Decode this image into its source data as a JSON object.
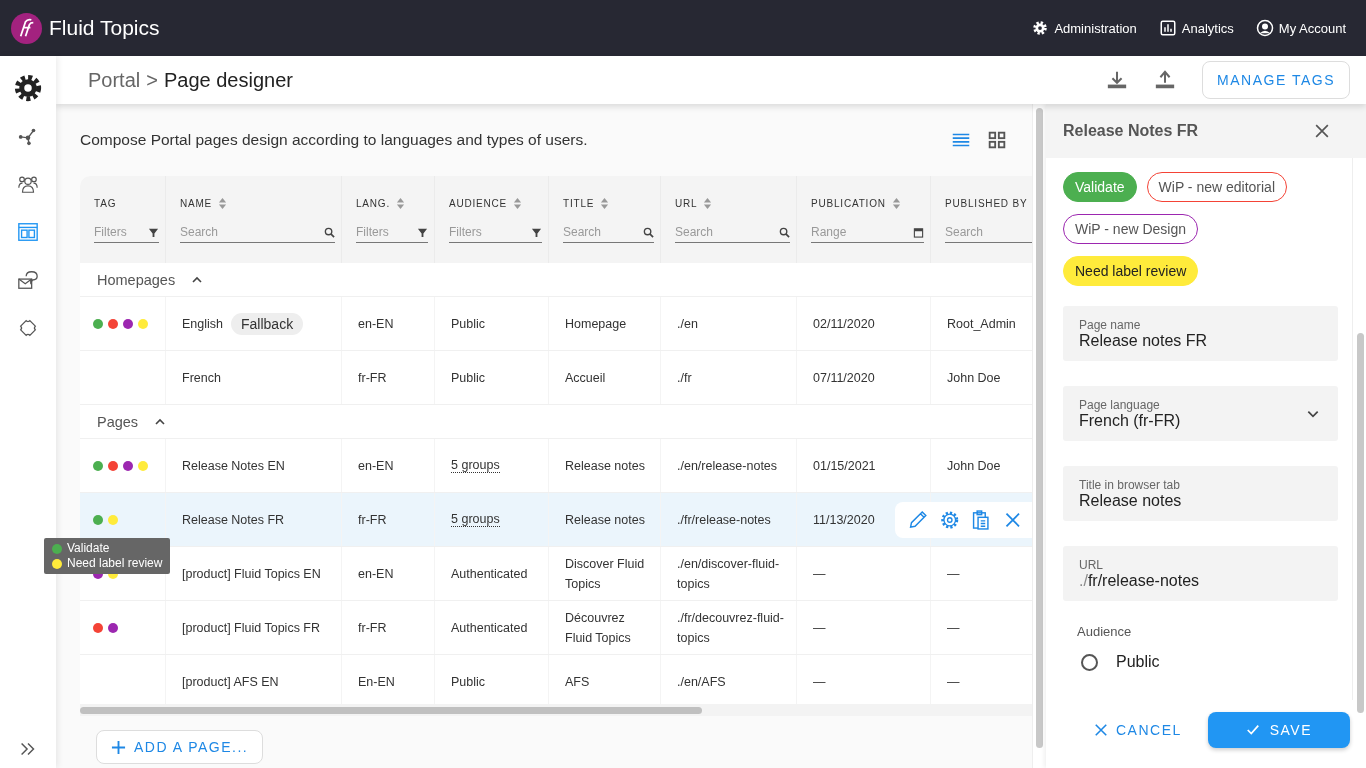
{
  "app": {
    "name": "Fluid Topics"
  },
  "top_nav": [
    "Administration",
    "Analytics",
    "My Account"
  ],
  "sidebar": {
    "items": [
      {
        "selected": false
      },
      {
        "selected": false
      },
      {
        "selected": false
      },
      {
        "selected": true
      },
      {
        "selected": false
      },
      {
        "selected": false
      }
    ]
  },
  "breadcrumb": {
    "parent": "Portal",
    "separator": ">",
    "current": "Page designer"
  },
  "header_actions": {
    "manage_tags": "MANAGE TAGS"
  },
  "description": "Compose Portal pages design according to languages and types of users.",
  "view_toggle": [
    {
      "selected": true
    },
    {
      "selected": false
    }
  ],
  "table": {
    "columns": [
      {
        "label": "TAG",
        "sortable": false,
        "filter": {
          "kind": "filter",
          "placeholder": "Filters"
        }
      },
      {
        "label": "NAME",
        "sortable": true,
        "filter": {
          "kind": "search",
          "placeholder": "Search"
        }
      },
      {
        "label": "LANG.",
        "sortable": true,
        "filter": {
          "kind": "filter",
          "placeholder": "Filters"
        }
      },
      {
        "label": "AUDIENCE",
        "sortable": true,
        "filter": {
          "kind": "filter",
          "placeholder": "Filters"
        }
      },
      {
        "label": "TITLE",
        "sortable": true,
        "filter": {
          "kind": "search",
          "placeholder": "Search"
        }
      },
      {
        "label": "URL",
        "sortable": true,
        "filter": {
          "kind": "search",
          "placeholder": "Search"
        }
      },
      {
        "label": "PUBLICATION",
        "sortable": true,
        "filter": {
          "kind": "range",
          "placeholder": "Range"
        }
      },
      {
        "label": "PUBLISHED BY",
        "filter": {
          "kind": "plain",
          "placeholder": "Search"
        }
      }
    ],
    "groups": [
      {
        "label": "Homepages",
        "expanded": true,
        "rows": [
          {
            "selected": false,
            "tags": [
              {
                "color": "#4caf50"
              },
              {
                "color": "#f44336"
              },
              {
                "color": "#9c27b0"
              },
              {
                "color": "#ffeb3b"
              }
            ],
            "name": "English",
            "badge": "Fallback",
            "lang": "en-EN",
            "audience": {
              "text": "Public",
              "kind": "text"
            },
            "title": "Homepage",
            "url": "./en",
            "publication": "02/11/2020",
            "published_by": "Root_Admin"
          },
          {
            "selected": false,
            "tags": [],
            "name": "French",
            "lang": "fr-FR",
            "audience": {
              "text": "Public",
              "kind": "text"
            },
            "title": "Accueil",
            "url": "./fr",
            "publication": "07/11/2020",
            "published_by": "John Doe"
          }
        ]
      },
      {
        "label": "Pages",
        "expanded": true,
        "rows": [
          {
            "selected": false,
            "tags": [
              {
                "color": "#4caf50"
              },
              {
                "color": "#f44336"
              },
              {
                "color": "#9c27b0"
              },
              {
                "color": "#ffeb3b"
              }
            ],
            "name": "Release Notes EN",
            "lang": "en-EN",
            "audience": {
              "text": "5 groups",
              "kind": "link"
            },
            "title": "Release notes",
            "url": "./en/release-notes",
            "publication": "01/15/2021",
            "published_by": "John Doe"
          },
          {
            "selected": true,
            "tags": [
              {
                "color": "#4caf50"
              },
              {
                "color": "#ffeb3b"
              }
            ],
            "name": "Release Notes FR",
            "lang": "fr-FR",
            "audience": {
              "text": "5 groups",
              "kind": "link"
            },
            "title": "Release notes",
            "url": "./fr/release-notes",
            "publication": "11/13/2020",
            "tooltip": [
              {
                "label": "Validate",
                "color": "#4caf50"
              },
              {
                "label": "Need label review",
                "color": "#ffeb3b"
              }
            ]
          },
          {
            "selected": false,
            "tags": [
              {
                "color": "#9c27b0"
              },
              {
                "color": "#ffeb3b"
              }
            ],
            "name": "[product] Fluid Topics EN",
            "lang": "en-EN",
            "audience": {
              "text": "Authenticated",
              "kind": "text"
            },
            "title": "Discover Fluid Topics",
            "url": "./en/discover-fluid-topics",
            "publication": "—",
            "published_by": "—"
          },
          {
            "selected": false,
            "tags": [
              {
                "color": "#f44336"
              },
              {
                "color": "#9c27b0"
              }
            ],
            "name": "[product] Fluid Topics FR",
            "lang": "fr-FR",
            "audience": {
              "text": "Authenticated",
              "kind": "text"
            },
            "title": "Découvrez Fluid Topics",
            "url": "./fr/decouvrez-fluid-topics",
            "publication": "—",
            "published_by": "—"
          },
          {
            "selected": false,
            "tags": [],
            "name": "[product] AFS EN",
            "lang": "En-EN",
            "audience": {
              "text": "Public",
              "kind": "text"
            },
            "title": "AFS",
            "url": "./en/AFS",
            "publication": "—",
            "published_by": "—"
          }
        ]
      }
    ]
  },
  "add_page": "ADD A PAGE...",
  "panel": {
    "title": "Release Notes FR",
    "tags": [
      {
        "label": "Validate",
        "color": "#4caf50",
        "filled": true
      },
      {
        "label": "WiP - new editorial",
        "color": "#f44336",
        "filled": false
      },
      {
        "label": "WiP - new Design",
        "color": "#9c27b0",
        "filled": false
      },
      {
        "label": "Need label review",
        "color": "#ffeb3b",
        "filled": true
      }
    ],
    "fields": [
      {
        "kind": "text",
        "label": "Page name",
        "value": "Release notes FR"
      },
      {
        "kind": "select",
        "label": "Page language",
        "value": "French (fr-FR)"
      },
      {
        "kind": "text",
        "label": "Title in browser tab",
        "value": "Release notes"
      },
      {
        "kind": "text",
        "label": "URL",
        "prefix": "./",
        "value": "fr/release-notes"
      }
    ],
    "audience": {
      "label": "Audience",
      "options": [
        {
          "label": "Public",
          "selected": false
        }
      ]
    },
    "cancel": "CANCEL",
    "save": "SAVE"
  }
}
